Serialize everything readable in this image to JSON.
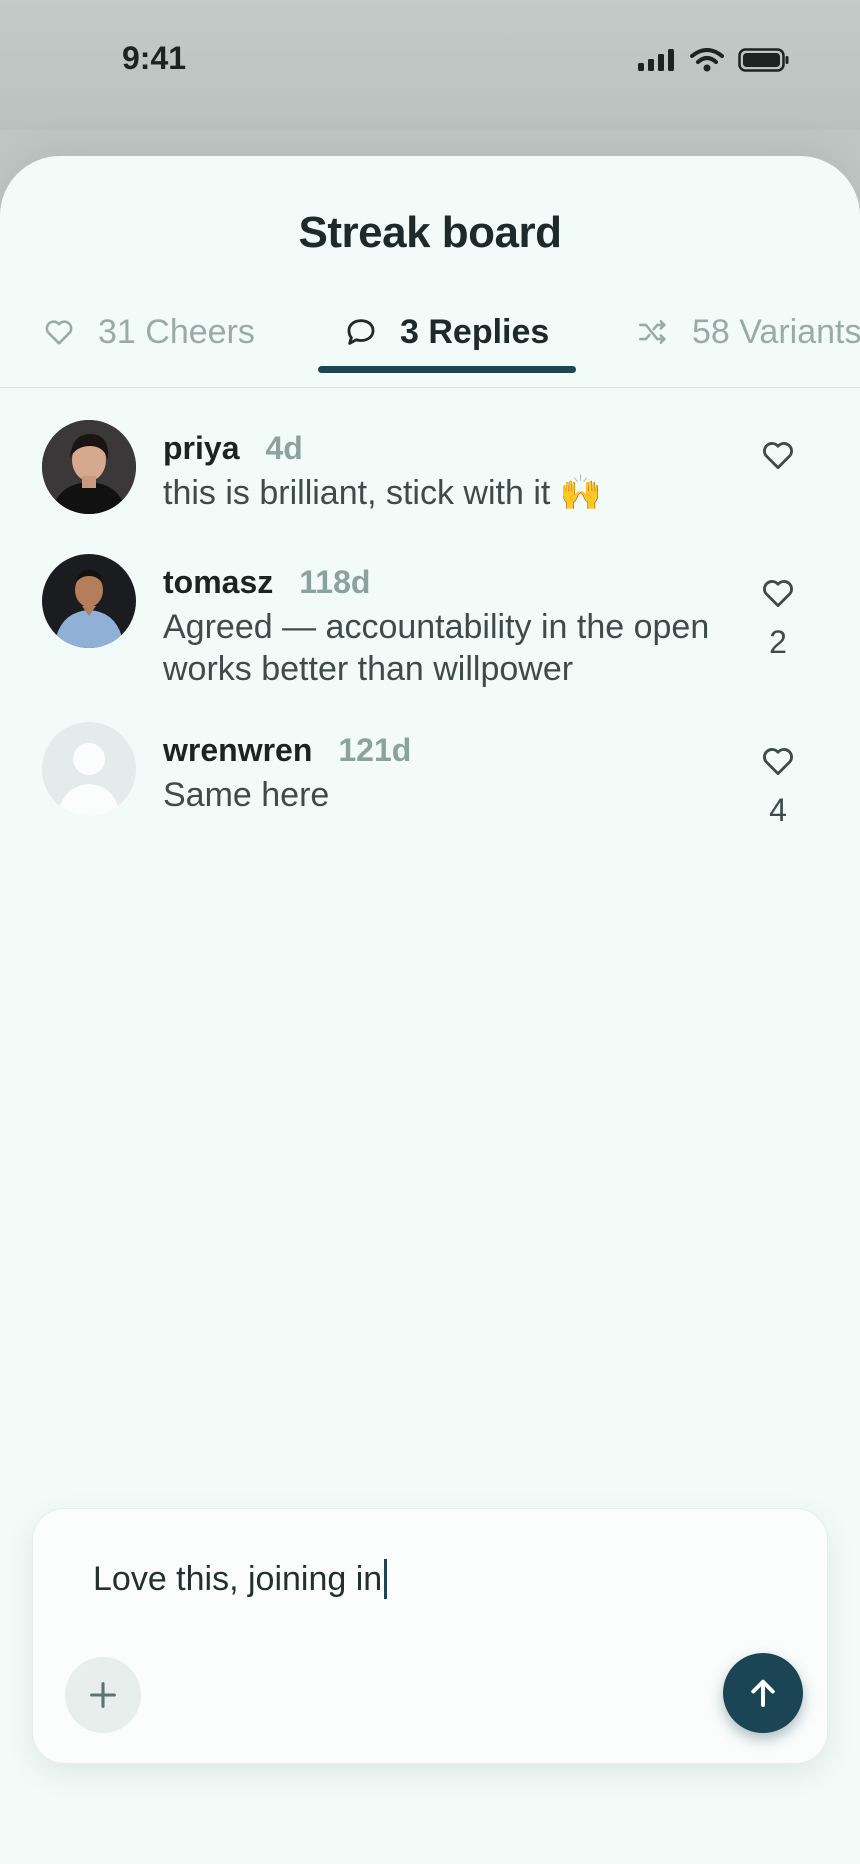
{
  "status_bar": {
    "time": "9:41"
  },
  "sheet": {
    "title": "Streak board"
  },
  "tabs": [
    {
      "icon": "heart-icon",
      "label": "31 Cheers",
      "active": false
    },
    {
      "icon": "comment-icon",
      "label": "3 Replies",
      "active": true
    },
    {
      "icon": "shuffle-icon",
      "label": "58 Variants",
      "active": false
    }
  ],
  "replies": [
    {
      "name": "priya",
      "age": "4d",
      "text": "this is brilliant, stick with it 🙌",
      "likes": ""
    },
    {
      "name": "tomasz",
      "age": "118d",
      "text": "Agreed — accountability in the open works better than willpower",
      "likes": "2"
    },
    {
      "name": "wrenwren",
      "age": "121d",
      "text": "Same here",
      "likes": "4"
    }
  ],
  "composer": {
    "value": "Love this, joining in"
  },
  "colors": {
    "accent": "#1b4454",
    "sheet_bg": "#f3fbf9",
    "muted": "#9aaba7"
  }
}
